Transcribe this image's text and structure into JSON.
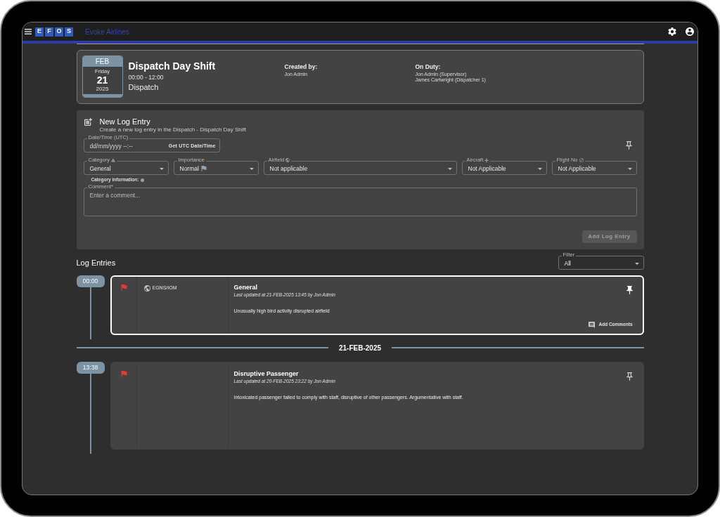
{
  "app_bar": {
    "logo_letters": [
      "E",
      "F",
      "O",
      "S"
    ],
    "airline": "Evoke Airlines"
  },
  "shift": {
    "calendar": {
      "month": "FEB",
      "weekday": "Friday",
      "day": "21",
      "year": "2025"
    },
    "title": "Dispatch Day Shift",
    "hours": "00:00 - 12:00",
    "department": "Dispatch",
    "created_by": {
      "label": "Created by:",
      "names": [
        "Jon Admin"
      ]
    },
    "on_duty": {
      "label": "On Duty:",
      "names": [
        "Jon Admin (Supervisor)",
        "James Cartwright (Dispatcher 1)"
      ]
    }
  },
  "new_entry": {
    "title": "New Log Entry",
    "subtitle": "Create a new log entry in the Dispatch - Dispatch Day Shift",
    "date_time": {
      "label": "Date/Time (UTC)",
      "placeholder": "dd/mm/yyyy --:--",
      "button": "Get UTC Date/Time"
    },
    "category": {
      "label": "Category",
      "value": "General"
    },
    "importance": {
      "label": "Importance",
      "value": "Normal"
    },
    "airfield": {
      "label": "Airfield",
      "value": "Not applicable"
    },
    "aircraft": {
      "label": "Aircraft",
      "value": "Not Applicable"
    },
    "flight_no": {
      "label": "Flight No",
      "value": "Not Applicable"
    },
    "category_information": "Category information:",
    "comment": {
      "label": "Comment*",
      "placeholder": "Enter a comment..."
    },
    "submit": {
      "label": "Add Log Entry",
      "disabled": true
    }
  },
  "log_entries": {
    "title": "Log Entries",
    "filter": {
      "label": "Filter",
      "value": "All"
    },
    "timeline": [
      {
        "kind": "entry",
        "time": "00:00",
        "color": "#e53935",
        "airfield": "EGNS/IOM",
        "title": "General",
        "updated": "Last updated at 21-FEB-2025 13:45 by Jon Admin",
        "text": "Unusually high bird activity disrupted airfield",
        "pinned": true,
        "selected": true,
        "action": "Add Comments"
      },
      {
        "kind": "date",
        "label": "21-FEB-2025"
      },
      {
        "kind": "entry",
        "time": "13:38",
        "color": "#e53935",
        "title": "Disruptive Passenger",
        "updated": "Last updated at 20-FEB-2025 23:22 by Jon Admin",
        "text": "Intoxicated passenger failed to comply with staff, disruptive of other passengers. Argumentative with staff.",
        "pinned": false,
        "selected": false
      }
    ]
  }
}
